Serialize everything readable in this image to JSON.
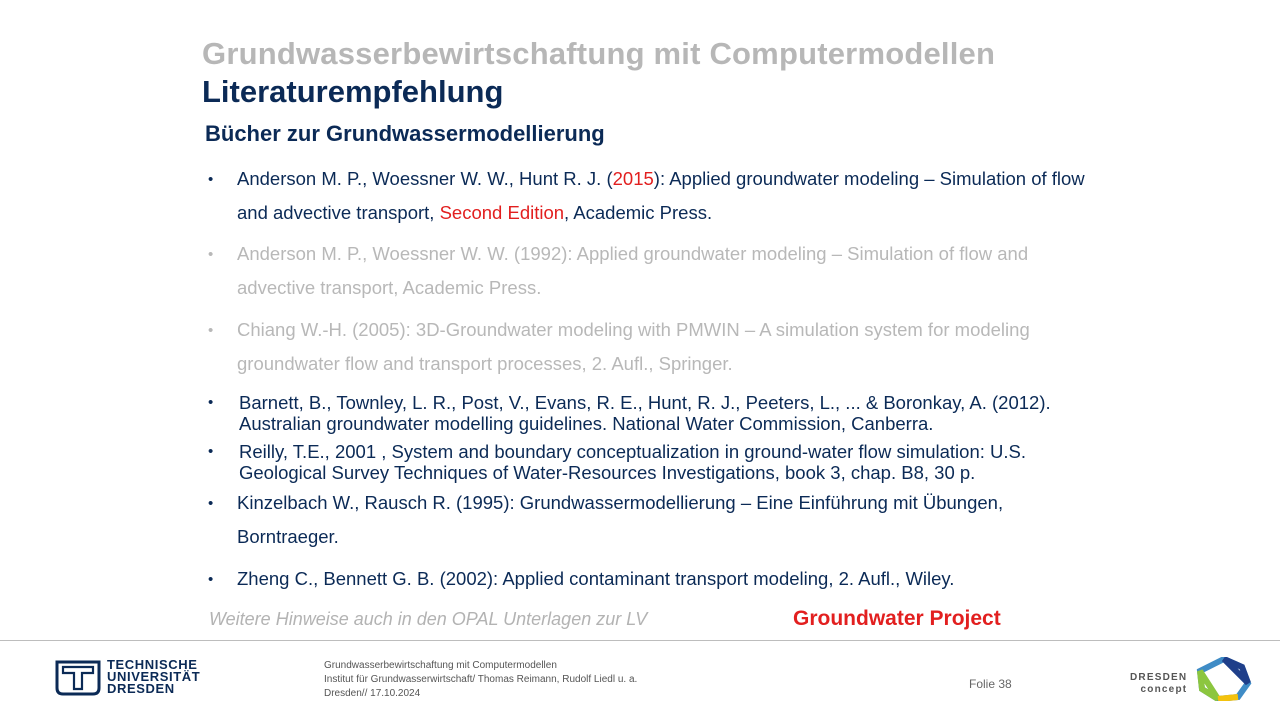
{
  "header": {
    "course_title": "Grundwasserbewirtschaftung mit Computermodellen",
    "slide_title": "Literaturempfehlung",
    "section_heading": "Bücher zur Grundwassermodellierung"
  },
  "bullet_symbol": "•",
  "references": [
    {
      "part1": "Anderson M. P., Woessner W. W., Hunt R. J. (",
      "year": "2015",
      "part2": "): Applied groundwater modeling – Simulation of flow and advective transport, ",
      "edition": "Second Edition",
      "part3": ", Academic Press."
    },
    {
      "text": "Anderson M. P., Woessner W. W. (1992): Applied groundwater modeling – Simulation of flow and advective transport, Academic Press."
    },
    {
      "text": "Chiang W.-H. (2005): 3D-Groundwater modeling with PMWIN – A simulation system for modeling groundwater flow and transport processes, 2. Aufl., Springer."
    },
    {
      "text": "Barnett, B., Townley, L. R., Post, V., Evans, R. E., Hunt, R. J., Peeters, L., ... & Boronkay, A. (2012). Australian groundwater modelling guidelines. National Water Commission, Canberra."
    },
    {
      "text": "Reilly, T.E., 2001 , System and boundary conceptualization in ground-water flow simulation: U.S. Geological Survey Techniques of Water-Resources Investigations, book 3, chap. B8, 30 p."
    },
    {
      "text": "Kinzelbach W., Rausch R. (1995): Grundwassermodellierung – Eine Einführung mit Übungen, Borntraeger."
    },
    {
      "text": "Zheng C., Bennett G. B. (2002): Applied contaminant transport modeling, 2. Aufl., Wiley."
    }
  ],
  "hint": "Weitere Hinweise auch in den OPAL Unterlagen zur LV",
  "groundwater_project_link": "Groundwater Project",
  "footer": {
    "university": {
      "line1": "TECHNISCHE",
      "line2": "UNIVERSITÄT",
      "line3": "DRESDEN"
    },
    "info_line1": "Grundwasserbewirtschaftung mit Computermodellen",
    "info_line2": "Institut für Grundwasserwirtschaft/ Thomas Reimann, Rudolf Liedl u. a.",
    "info_line3": "Dresden// 17.10.2024",
    "slide_number": "Folie 38",
    "dresden_concept": {
      "line1": "DRESDEN",
      "line2": "concept"
    }
  },
  "colors": {
    "navy": "#0b2a56",
    "gray_title": "#b7b7b7",
    "highlight_red": "#e21f1f",
    "dimmed_text": "#b8b8b8"
  }
}
